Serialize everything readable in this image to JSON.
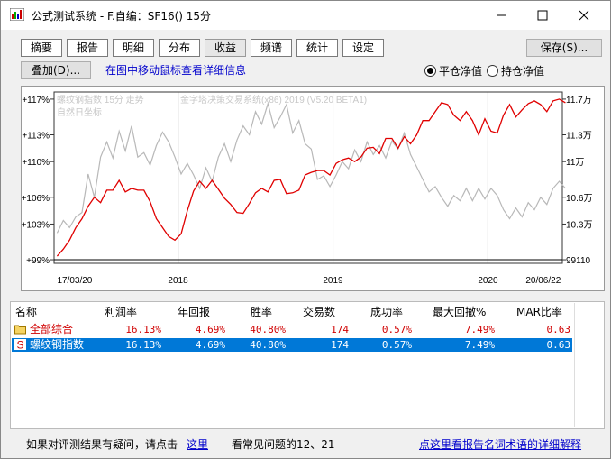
{
  "window": {
    "app_name": "公式测试系统",
    "separator": "-",
    "title_detail": "F.自编：SF16() 15分",
    "minimize_icon": "minimize-icon",
    "maximize_icon": "maximize-icon",
    "close_icon": "close-icon"
  },
  "tabs": [
    "摘要",
    "报告",
    "明细",
    "分布",
    "收益",
    "频谱",
    "统计",
    "设定"
  ],
  "active_tab": "收益",
  "buttons": {
    "save": "保存(S)...",
    "overlay": "叠加(D)..."
  },
  "hint_text": "在图中移动鼠标查看详细信息",
  "radios": [
    {
      "label": "平仓净值",
      "checked": true
    },
    {
      "label": "持仓净值",
      "checked": false
    }
  ],
  "chart_data": {
    "type": "line",
    "legend": [
      "螺纹钢指数 15分 走势",
      "金字塔决策交易系统(x86) 2019 (V5.20 BETA1)"
    ],
    "axis_mode_label": "自然日坐标",
    "x_range": [
      "17/03/20",
      "20/06/22"
    ],
    "x_ticks": [
      "17/03/20",
      "2018",
      "2019",
      "2020",
      "20/06/22"
    ],
    "y_left_ticks": [
      "+117%",
      "+113%",
      "+110%",
      "+106%",
      "+103%",
      "+99%"
    ],
    "y_right_ticks": [
      "11.7万",
      "11.3万",
      "11万",
      "10.6万",
      "10.3万",
      "99110"
    ],
    "series": [
      {
        "name": "螺纹钢指数 15分 走势",
        "color": "#b8b8b8",
        "points": [
          [
            2017.22,
            102.0
          ],
          [
            2017.26,
            103.4
          ],
          [
            2017.3,
            102.6
          ],
          [
            2017.34,
            103.8
          ],
          [
            2017.38,
            104.3
          ],
          [
            2017.42,
            108.6
          ],
          [
            2017.46,
            106.0
          ],
          [
            2017.5,
            110.5
          ],
          [
            2017.54,
            112.2
          ],
          [
            2017.58,
            110.4
          ],
          [
            2017.62,
            113.4
          ],
          [
            2017.66,
            111.2
          ],
          [
            2017.7,
            114.0
          ],
          [
            2017.74,
            110.5
          ],
          [
            2017.78,
            111.0
          ],
          [
            2017.82,
            109.6
          ],
          [
            2017.86,
            111.8
          ],
          [
            2017.9,
            113.3
          ],
          [
            2017.94,
            112.2
          ],
          [
            2017.98,
            110.5
          ],
          [
            2018.02,
            108.6
          ],
          [
            2018.06,
            109.8
          ],
          [
            2018.1,
            108.5
          ],
          [
            2018.14,
            107.0
          ],
          [
            2018.18,
            109.3
          ],
          [
            2018.22,
            107.8
          ],
          [
            2018.26,
            110.5
          ],
          [
            2018.3,
            112.0
          ],
          [
            2018.34,
            110.0
          ],
          [
            2018.38,
            112.4
          ],
          [
            2018.42,
            114.0
          ],
          [
            2018.46,
            113.0
          ],
          [
            2018.5,
            115.6
          ],
          [
            2018.54,
            114.2
          ],
          [
            2018.58,
            116.5
          ],
          [
            2018.62,
            113.8
          ],
          [
            2018.66,
            115.0
          ],
          [
            2018.7,
            116.4
          ],
          [
            2018.74,
            113.2
          ],
          [
            2018.78,
            114.6
          ],
          [
            2018.82,
            112.0
          ],
          [
            2018.86,
            111.4
          ],
          [
            2018.9,
            108.0
          ],
          [
            2018.94,
            108.4
          ],
          [
            2018.98,
            107.2
          ],
          [
            2019.02,
            108.5
          ],
          [
            2019.06,
            110.0
          ],
          [
            2019.1,
            109.2
          ],
          [
            2019.14,
            111.3
          ],
          [
            2019.18,
            110.0
          ],
          [
            2019.22,
            112.2
          ],
          [
            2019.26,
            110.8
          ],
          [
            2019.3,
            111.8
          ],
          [
            2019.34,
            110.4
          ],
          [
            2019.38,
            112.3
          ],
          [
            2019.42,
            111.4
          ],
          [
            2019.46,
            113.2
          ],
          [
            2019.5,
            110.8
          ],
          [
            2019.54,
            109.4
          ],
          [
            2019.58,
            108.0
          ],
          [
            2019.62,
            106.6
          ],
          [
            2019.66,
            107.2
          ],
          [
            2019.7,
            106.0
          ],
          [
            2019.74,
            105.0
          ],
          [
            2019.78,
            106.2
          ],
          [
            2019.82,
            105.6
          ],
          [
            2019.86,
            107.0
          ],
          [
            2019.9,
            105.6
          ],
          [
            2019.94,
            107.0
          ],
          [
            2019.98,
            105.8
          ],
          [
            2020.02,
            107.0
          ],
          [
            2020.06,
            106.2
          ],
          [
            2020.1,
            104.6
          ],
          [
            2020.14,
            103.6
          ],
          [
            2020.18,
            104.8
          ],
          [
            2020.22,
            103.8
          ],
          [
            2020.26,
            105.4
          ],
          [
            2020.3,
            104.6
          ],
          [
            2020.34,
            106.0
          ],
          [
            2020.38,
            105.2
          ],
          [
            2020.42,
            107.0
          ],
          [
            2020.46,
            107.8
          ],
          [
            2020.5,
            107.0
          ]
        ]
      },
      {
        "name": "金字塔决策交易系统 净值",
        "color": "#e00000",
        "points": [
          [
            2017.22,
            99.4
          ],
          [
            2017.26,
            100.2
          ],
          [
            2017.3,
            101.2
          ],
          [
            2017.34,
            102.6
          ],
          [
            2017.38,
            103.6
          ],
          [
            2017.42,
            105.0
          ],
          [
            2017.46,
            106.0
          ],
          [
            2017.5,
            105.4
          ],
          [
            2017.54,
            106.8
          ],
          [
            2017.58,
            106.8
          ],
          [
            2017.62,
            107.9
          ],
          [
            2017.66,
            106.6
          ],
          [
            2017.7,
            107.0
          ],
          [
            2017.74,
            106.8
          ],
          [
            2017.78,
            106.8
          ],
          [
            2017.82,
            105.5
          ],
          [
            2017.86,
            103.6
          ],
          [
            2017.9,
            102.6
          ],
          [
            2017.94,
            101.6
          ],
          [
            2017.98,
            101.2
          ],
          [
            2018.02,
            101.9
          ],
          [
            2018.06,
            104.5
          ],
          [
            2018.1,
            106.7
          ],
          [
            2018.14,
            107.8
          ],
          [
            2018.18,
            107.0
          ],
          [
            2018.22,
            107.9
          ],
          [
            2018.26,
            106.9
          ],
          [
            2018.3,
            105.9
          ],
          [
            2018.34,
            105.2
          ],
          [
            2018.38,
            104.3
          ],
          [
            2018.42,
            104.2
          ],
          [
            2018.46,
            105.3
          ],
          [
            2018.5,
            106.5
          ],
          [
            2018.54,
            107.0
          ],
          [
            2018.58,
            106.6
          ],
          [
            2018.62,
            107.9
          ],
          [
            2018.66,
            108.0
          ],
          [
            2018.7,
            106.4
          ],
          [
            2018.74,
            106.5
          ],
          [
            2018.78,
            106.8
          ],
          [
            2018.82,
            108.5
          ],
          [
            2018.86,
            108.8
          ],
          [
            2018.9,
            109.0
          ],
          [
            2018.94,
            109.0
          ],
          [
            2018.98,
            108.5
          ],
          [
            2019.02,
            109.8
          ],
          [
            2019.06,
            110.2
          ],
          [
            2019.1,
            110.4
          ],
          [
            2019.14,
            110.0
          ],
          [
            2019.18,
            110.5
          ],
          [
            2019.22,
            111.5
          ],
          [
            2019.26,
            111.6
          ],
          [
            2019.3,
            110.9
          ],
          [
            2019.34,
            112.6
          ],
          [
            2019.38,
            112.6
          ],
          [
            2019.42,
            111.5
          ],
          [
            2019.46,
            112.8
          ],
          [
            2019.5,
            112.0
          ],
          [
            2019.54,
            113.0
          ],
          [
            2019.58,
            114.6
          ],
          [
            2019.62,
            114.6
          ],
          [
            2019.66,
            115.6
          ],
          [
            2019.7,
            116.6
          ],
          [
            2019.74,
            116.4
          ],
          [
            2019.78,
            115.2
          ],
          [
            2019.82,
            114.6
          ],
          [
            2019.86,
            115.6
          ],
          [
            2019.9,
            114.6
          ],
          [
            2019.94,
            113.0
          ],
          [
            2019.98,
            114.8
          ],
          [
            2020.02,
            113.4
          ],
          [
            2020.06,
            113.2
          ],
          [
            2020.1,
            115.2
          ],
          [
            2020.14,
            116.4
          ],
          [
            2020.18,
            115.0
          ],
          [
            2020.22,
            115.8
          ],
          [
            2020.26,
            116.5
          ],
          [
            2020.3,
            116.8
          ],
          [
            2020.34,
            116.4
          ],
          [
            2020.38,
            115.6
          ],
          [
            2020.42,
            116.8
          ],
          [
            2020.46,
            117.0
          ],
          [
            2020.5,
            116.6
          ]
        ]
      }
    ]
  },
  "table": {
    "headers": [
      "名称",
      "利润率",
      "年回报",
      "胜率",
      "交易数",
      "成功率",
      "最大回撤%",
      "MAR比率"
    ],
    "rows": [
      {
        "icon": "folder-icon",
        "name": "全部综合",
        "profit": "16.13%",
        "annual": "4.69%",
        "winrate": "40.80%",
        "trades": "174",
        "success": "0.57%",
        "drawdown": "7.49%",
        "mar": "0.63",
        "color": "#d00000",
        "selected": false
      },
      {
        "icon": "strategy-s-icon",
        "name": "螺纹钢指数",
        "profit": "16.13%",
        "annual": "4.69%",
        "winrate": "40.80%",
        "trades": "174",
        "success": "0.57%",
        "drawdown": "7.49%",
        "mar": "0.63",
        "color": "#ffffff",
        "selected": true
      }
    ]
  },
  "footer": {
    "question_text": "如果对评测结果有疑问，请点击",
    "here_link": "这里",
    "faq_text": "看常见问题的12、21",
    "glossary_link": "点这里看报告名词术语的详细解释"
  }
}
